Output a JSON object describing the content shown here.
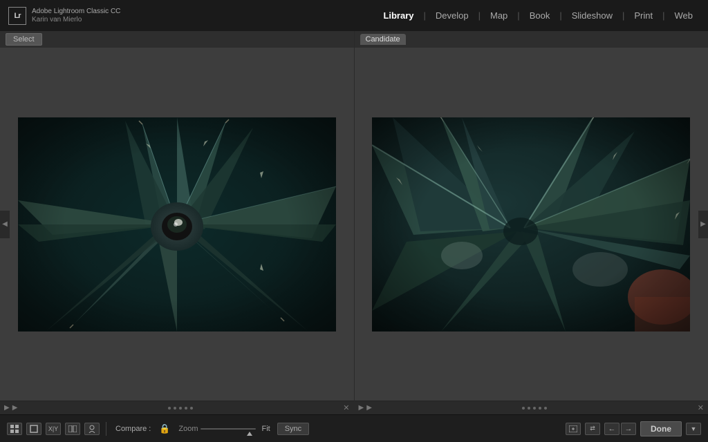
{
  "app": {
    "logo": "Lr",
    "title": "Adobe Lightroom Classic CC",
    "user": "Karin van Mierlo"
  },
  "nav": {
    "items": [
      "Library",
      "Develop",
      "Map",
      "Book",
      "Slideshow",
      "Print",
      "Web"
    ],
    "active": "Library"
  },
  "panels": {
    "left": {
      "label": "Select",
      "image_alt": "Agave plant close-up, top view"
    },
    "right": {
      "label": "Candidate",
      "image_alt": "Agave plant close-up, side view"
    }
  },
  "toolbar": {
    "compare_label": "Compare :",
    "zoom_label": "Zoom",
    "zoom_fit": "Fit",
    "sync_label": "Sync",
    "done_label": "Done"
  },
  "scrollbar": {
    "dots": [
      "·",
      "·",
      "·",
      "·",
      "·"
    ]
  }
}
